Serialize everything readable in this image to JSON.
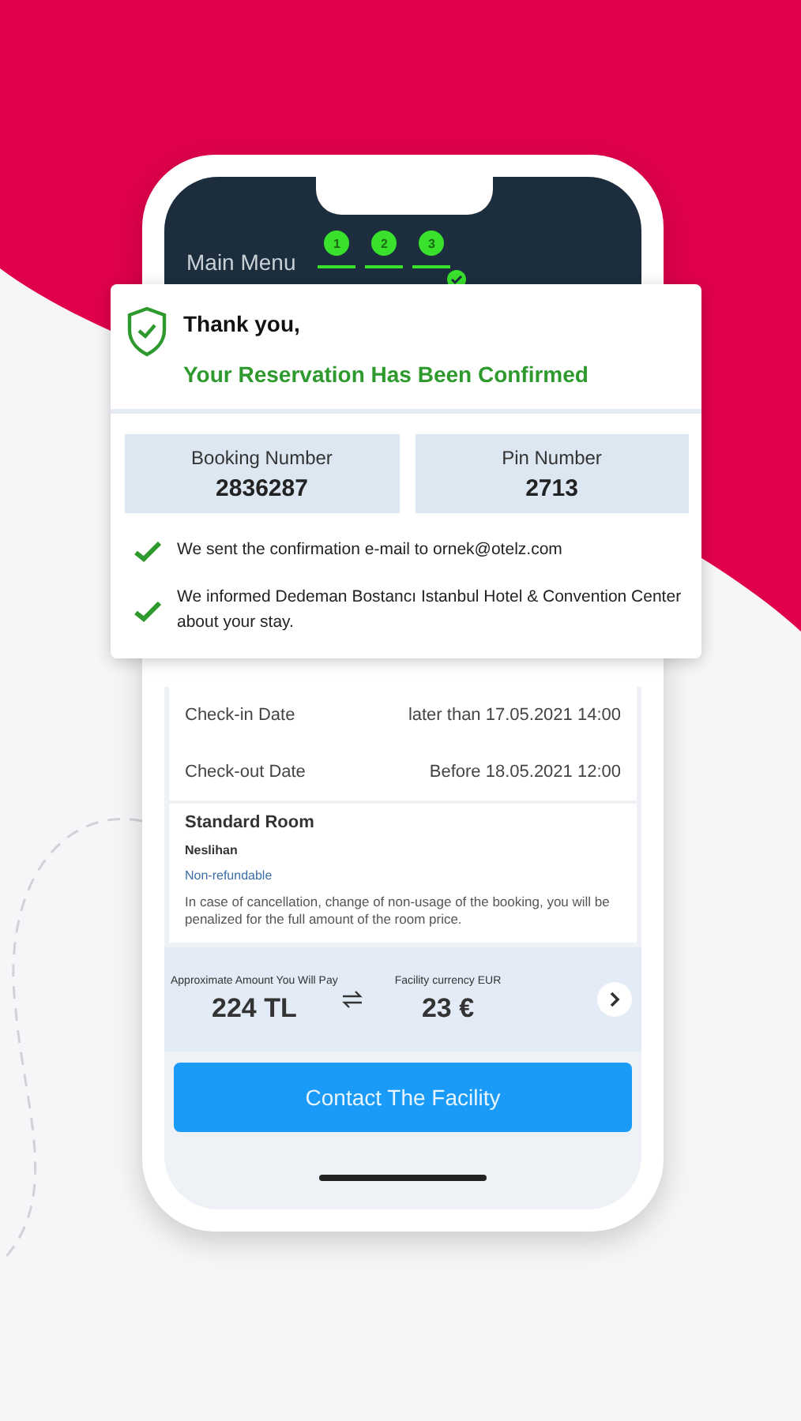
{
  "header": {
    "title": "Main Menu",
    "steps": [
      "1",
      "2",
      "3"
    ]
  },
  "confirmation": {
    "greeting": "Thank you,",
    "message": "Your Reservation Has Been Confirmed",
    "codes": [
      {
        "label": "Booking Number",
        "value": "2836287"
      },
      {
        "label": "Pin Number",
        "value": "2713"
      }
    ],
    "notices": [
      "We sent the confirmation e-mail to ornek@otelz.com",
      "We informed Dedeman Bostancı Istanbul Hotel & Convention Center about your stay."
    ]
  },
  "stay": {
    "dates": [
      {
        "label": "Check-in Date",
        "value": "later than 17.05.2021 14:00"
      },
      {
        "label": "Check-out Date",
        "value": "Before 18.05.2021 12:00"
      }
    ],
    "room": {
      "name": "Standard Room",
      "guest": "Neslihan",
      "policy": "Non-refundable",
      "note": "In case of cancellation, change of non-usage of the booking, you will be penalized for the full amount of the room price."
    }
  },
  "price": {
    "local_label": "Approximate Amount You Will Pay",
    "local_amount": "224 TL",
    "facility_label": "Facility currency EUR",
    "facility_amount": "23 €"
  },
  "button": "Contact The Facility"
}
